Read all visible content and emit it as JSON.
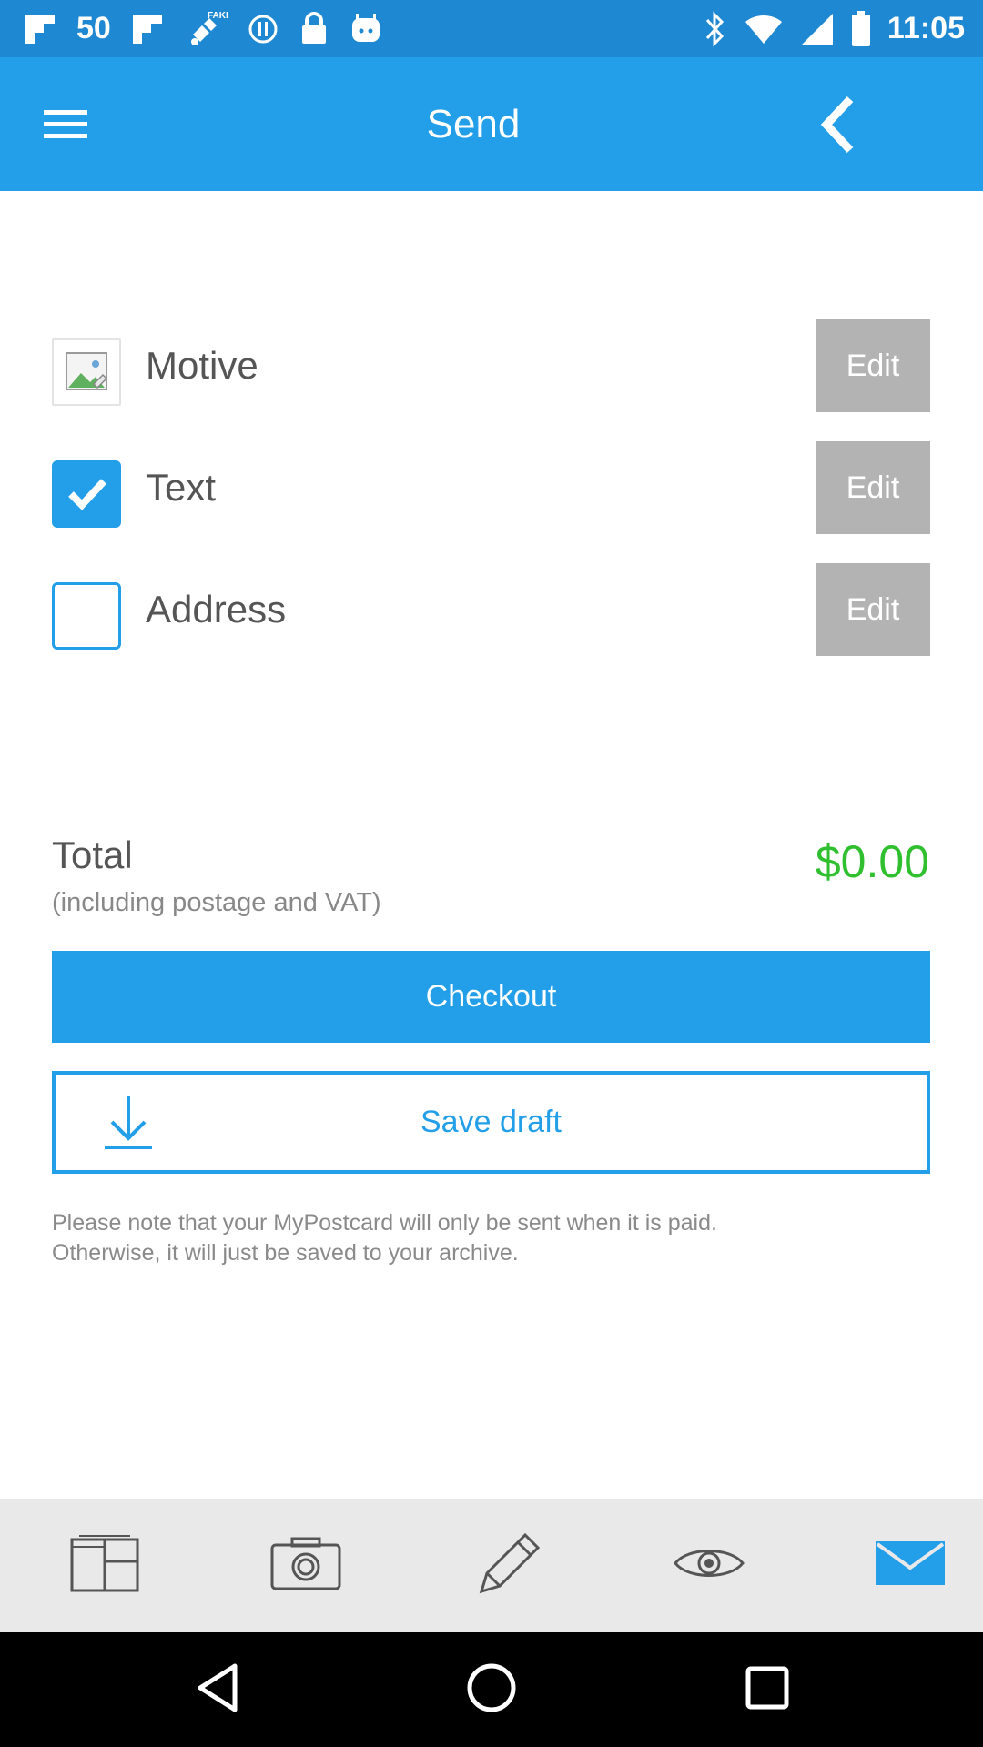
{
  "status_bar": {
    "signal_label": "50",
    "time": "11:05",
    "fake_badge": "FAKE"
  },
  "header": {
    "title": "Send",
    "menu_icon": "hamburger-menu-icon",
    "back_icon": "chevron-left-icon"
  },
  "items": [
    {
      "label": "Motive",
      "edit_label": "Edit",
      "icon": "image-thumbnail-icon",
      "checked": null
    },
    {
      "label": "Text",
      "edit_label": "Edit",
      "icon": "checkbox-icon",
      "checked": true
    },
    {
      "label": "Address",
      "edit_label": "Edit",
      "icon": "checkbox-icon",
      "checked": false
    }
  ],
  "total": {
    "label": "Total",
    "sublabel": "(including postage and VAT)",
    "amount": "$0.00"
  },
  "actions": {
    "checkout_label": "Checkout",
    "save_draft_label": "Save draft"
  },
  "note": {
    "line1": "Please note that your MyPostcard will only be sent when it is paid.",
    "line2": "Otherwise, it will just be saved to your archive."
  },
  "bottom_tabs": [
    {
      "icon": "layout-grid-icon"
    },
    {
      "icon": "camera-icon"
    },
    {
      "icon": "pencil-icon"
    },
    {
      "icon": "eye-icon"
    },
    {
      "icon": "envelope-icon",
      "active": true
    }
  ],
  "colors": {
    "status_bar": "#1e88d2",
    "app_bar": "#239fe9",
    "accent": "#239fe9",
    "price_green": "#2fbf2f",
    "edit_gray": "#b3b3b3",
    "tab_bar_bg": "#e9e9ea"
  }
}
